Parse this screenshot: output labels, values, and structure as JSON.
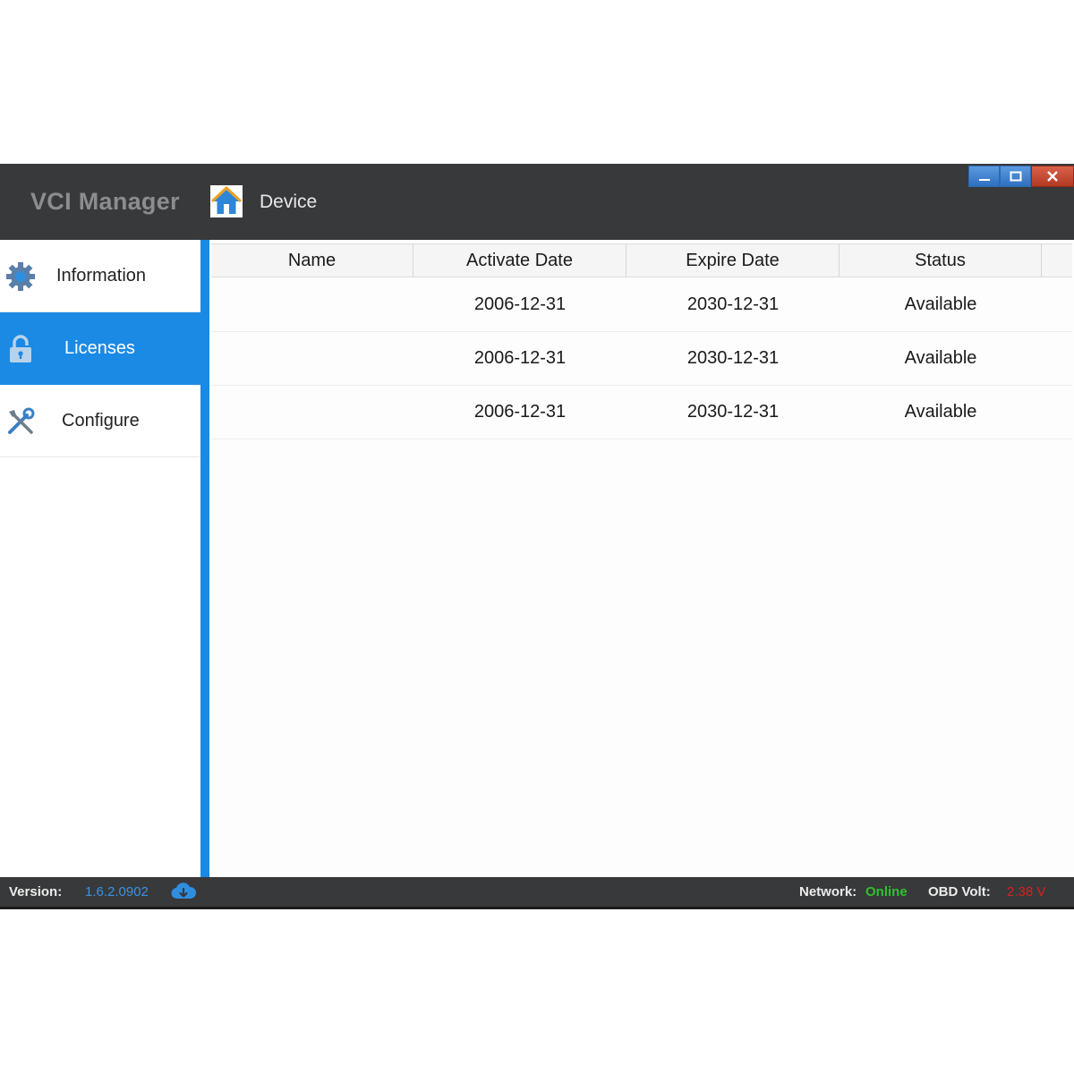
{
  "app": {
    "title": "VCI Manager",
    "breadcrumb": "Device",
    "window_controls": [
      "minimize",
      "maximize",
      "close"
    ]
  },
  "sidebar": {
    "items": [
      {
        "label": "Information",
        "icon": "gear-icon",
        "active": false
      },
      {
        "label": "Licenses",
        "icon": "lock-icon",
        "active": true
      },
      {
        "label": "Configure",
        "icon": "tools-icon",
        "active": false
      }
    ]
  },
  "table": {
    "columns": [
      "Name",
      "Activate Date",
      "Expire Date",
      "Status"
    ],
    "rows": [
      {
        "name": "",
        "activate": "2006-12-31",
        "expire": "2030-12-31",
        "status": "Available"
      },
      {
        "name": "",
        "activate": "2006-12-31",
        "expire": "2030-12-31",
        "status": "Available"
      },
      {
        "name": "",
        "activate": "2006-12-31",
        "expire": "2030-12-31",
        "status": "Available"
      }
    ]
  },
  "statusbar": {
    "version_label": "Version:",
    "version_value": "1.6.2.0902",
    "network_label": "Network:",
    "network_value": "Online",
    "obd_label": "OBD Volt:",
    "obd_value": "2.38 V"
  },
  "colors": {
    "accent": "#1a8ae5",
    "titlebar": "#38393b",
    "online": "#2fc12f",
    "volt": "#d52222"
  }
}
